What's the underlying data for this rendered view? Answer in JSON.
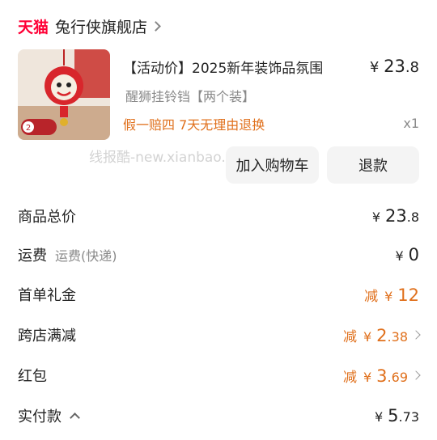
{
  "store": {
    "brand": "天猫",
    "name": "兔行侠旗舰店"
  },
  "product": {
    "title": "【活动价】2025新年装饰品氛围",
    "price": {
      "symbol": "¥",
      "int": "23",
      "dec": ".8"
    },
    "spec": "醒狮挂铃铛【两个装】",
    "service": "假一赔四  7天无理由退换",
    "quantity": "x1",
    "thumb_badge": "2"
  },
  "watermark": "线报酷-new.xianbao.fun",
  "actions": {
    "add_to_cart": "加入购物车",
    "refund": "退款"
  },
  "summary": {
    "total": {
      "label": "商品总价",
      "symbol": "¥",
      "int": "23",
      "dec": ".8"
    },
    "shipping": {
      "label": "运费",
      "sub": "运费(快递)",
      "symbol": "¥",
      "int": "0",
      "dec": ""
    },
    "first_order": {
      "label": "首单礼金",
      "prefix": "减",
      "symbol": "¥",
      "int": "12",
      "dec": ""
    },
    "cross_store": {
      "label": "跨店满减",
      "prefix": "减",
      "symbol": "¥",
      "int": "2",
      "dec": ".38"
    },
    "red_packet": {
      "label": "红包",
      "prefix": "减",
      "symbol": "¥",
      "int": "3",
      "dec": ".69"
    },
    "paid": {
      "label": "实付款",
      "symbol": "¥",
      "int": "5",
      "dec": ".73"
    }
  }
}
